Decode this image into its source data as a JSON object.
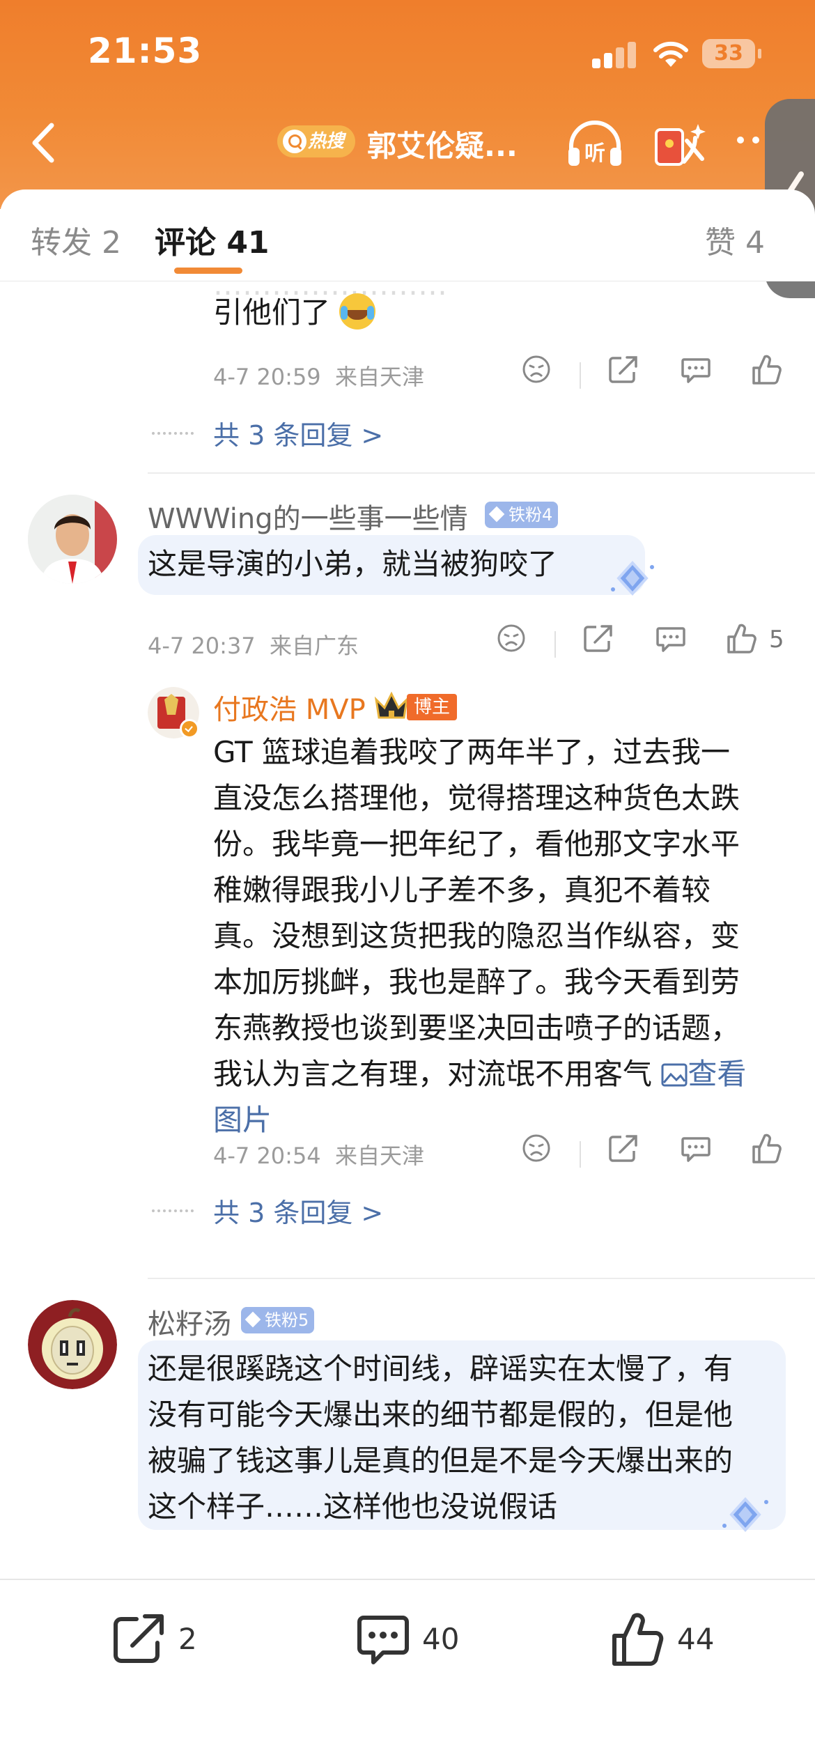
{
  "status": {
    "time": "21:53",
    "battery": "33"
  },
  "nav": {
    "hot_label": "热搜",
    "title": "郭艾伦疑...",
    "listen_label": "听"
  },
  "tabs": {
    "repost": "转发 2",
    "comment": "评论 41",
    "like": "赞 4"
  },
  "comments": [
    {
      "partial_text": "引他们了",
      "time": "4-7 20:59",
      "location": "来自天津",
      "replies": "共 3 条回复 >"
    },
    {
      "username": "WWWing的一些事一些情",
      "badge": "铁粉4",
      "text": "这是导演的小弟，就当被狗咬了",
      "time": "4-7 20:37",
      "location": "来自广东",
      "likes": "5",
      "reply": {
        "username": "付政浩 MVP",
        "role_badge": "博主",
        "text_lines": [
          "GT 篮球追着我咬了两年半了，过去我一",
          "直没怎么搭理他，觉得搭理这种货色太跌",
          "份。我毕竟一把年纪了，看他那文字水平",
          "稚嫩得跟我小儿子差不多，真犯不着较",
          "真。没想到这货把我的隐忍当作纵容，变",
          "本加厉挑衅，我也是醉了。我今天看到劳",
          "东燕教授也谈到要坚决回击喷子的话题，",
          "我认为言之有理，对流氓不用客气"
        ],
        "view_image": "查看",
        "view_image_2": "图片",
        "time": "4-7 20:54",
        "location": "来自天津"
      },
      "replies": "共 3 条回复 >"
    },
    {
      "username": "松籽汤",
      "badge": "铁粉5",
      "text_lines": [
        "还是很蹊跷这个时间线，辟谣实在太慢了，有",
        "没有可能今天爆出来的细节都是假的，但是他",
        "被骗了钱这事儿是真的但是不是今天爆出来的",
        "这个样子……这样他也没说假话"
      ]
    }
  ],
  "bottom": {
    "repost_count": "2",
    "comment_count": "40",
    "like_count": "44"
  },
  "colors": {
    "header": "#ef7e2c",
    "link": "#4b6fa8",
    "accent": "#f18a36"
  }
}
